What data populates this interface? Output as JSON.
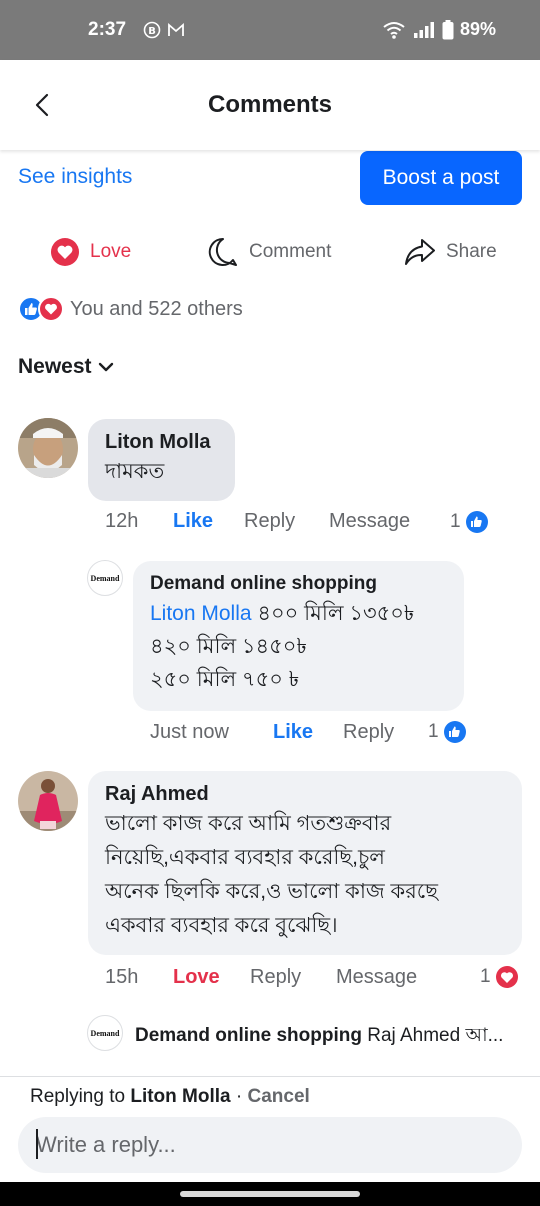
{
  "status_bar": {
    "time": "2:37",
    "battery": "89%",
    "icons": [
      "b-badge-icon",
      "gmail-icon",
      "wifi-icon",
      "signal-icon",
      "battery-icon"
    ]
  },
  "header": {
    "title": "Comments",
    "back_icon": "chevron-left-icon"
  },
  "insights": {
    "label": "See insights"
  },
  "boost": {
    "label": "Boost a post"
  },
  "actions": {
    "love": "Love",
    "comment": "Comment",
    "share": "Share"
  },
  "reactions": {
    "summary": "You and 522 others"
  },
  "sort": {
    "label": "Newest"
  },
  "comments": [
    {
      "author": "Liton Molla",
      "text": "দামকত",
      "time": "12h",
      "like": "Like",
      "reply": "Reply",
      "message": "Message",
      "reaction_count": "1",
      "reply_item": {
        "author": "Demand online shopping",
        "avatar_text": "Demand",
        "mention": "Liton Molla",
        "line1": "৪০০ মিলি ১৩৫০৳",
        "line2": "৪২০ মিলি ১৪৫০৳",
        "line3": "২৫০ মিলি ৭৫০ ৳",
        "time": "Just now",
        "like": "Like",
        "reply": "Reply",
        "reaction_count": "1"
      }
    },
    {
      "author": "Raj Ahmed",
      "line1": "ভালো কাজ করে আমি গতশুক্রবার",
      "line2": "নিয়েছি,একবার ব্যবহার করেছি,চুল",
      "line3": "অনেক ছিলকি করে,ও ভালো কাজ করছে",
      "line4": "একবার ব্যবহার করে বুঝেছি।",
      "time": "15h",
      "love": "Love",
      "reply": "Reply",
      "message": "Message",
      "reaction_count": "1",
      "reply_preview": {
        "author": "Demand online shopping",
        "avatar_text": "Demand",
        "text": "Raj Ahmed আ..."
      }
    }
  ],
  "composer": {
    "replying_prefix": "Replying to",
    "replying_name": "Liton Molla",
    "separator": "·",
    "cancel": "Cancel",
    "placeholder": "Write a reply..."
  },
  "colors": {
    "accent": "#0866ff",
    "link": "#1877f2",
    "love": "#e4314b",
    "bubble": "#e4e6eb"
  }
}
